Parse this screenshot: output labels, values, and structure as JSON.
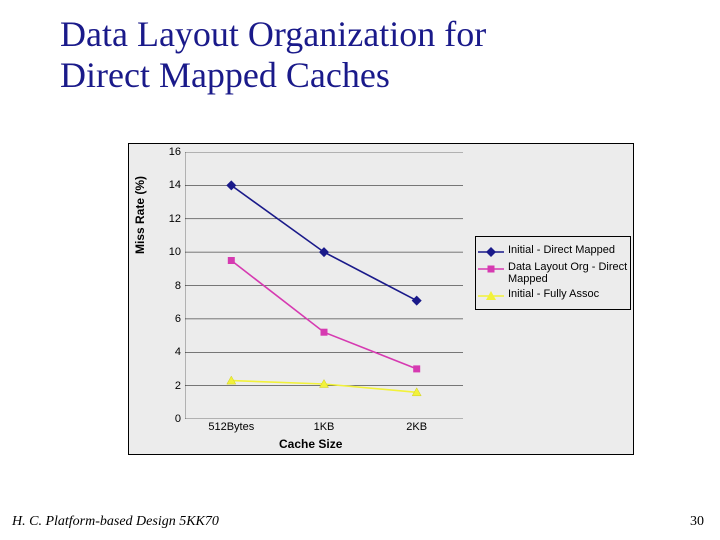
{
  "title_line1": "Data Layout Organization for",
  "title_line2": "Direct Mapped Caches",
  "footer_left": "H. C.   Platform-based Design 5KK70",
  "footer_right": "30",
  "chart_data": {
    "type": "line",
    "xlabel": "Cache Size",
    "ylabel": "Miss Rate (%)",
    "ylim": [
      0,
      16
    ],
    "yticks": [
      "16",
      "14",
      "12",
      "10",
      "8",
      "6",
      "4",
      "2",
      "0"
    ],
    "categories": [
      "512Bytes",
      "1KB",
      "2KB"
    ],
    "series": [
      {
        "name": "Initial - Direct Mapped",
        "color": "#1a1a8a",
        "marker": "diamond",
        "values": [
          14.0,
          10.0,
          7.1
        ]
      },
      {
        "name": "Data Layout Org - Direct Mapped",
        "color": "#d63ab1",
        "marker": "square",
        "values": [
          9.5,
          5.2,
          3.0
        ]
      },
      {
        "name": "Initial - Fully Assoc",
        "color": "#f2f23a",
        "marker": "triangle",
        "values": [
          2.3,
          2.1,
          1.6
        ]
      }
    ]
  }
}
